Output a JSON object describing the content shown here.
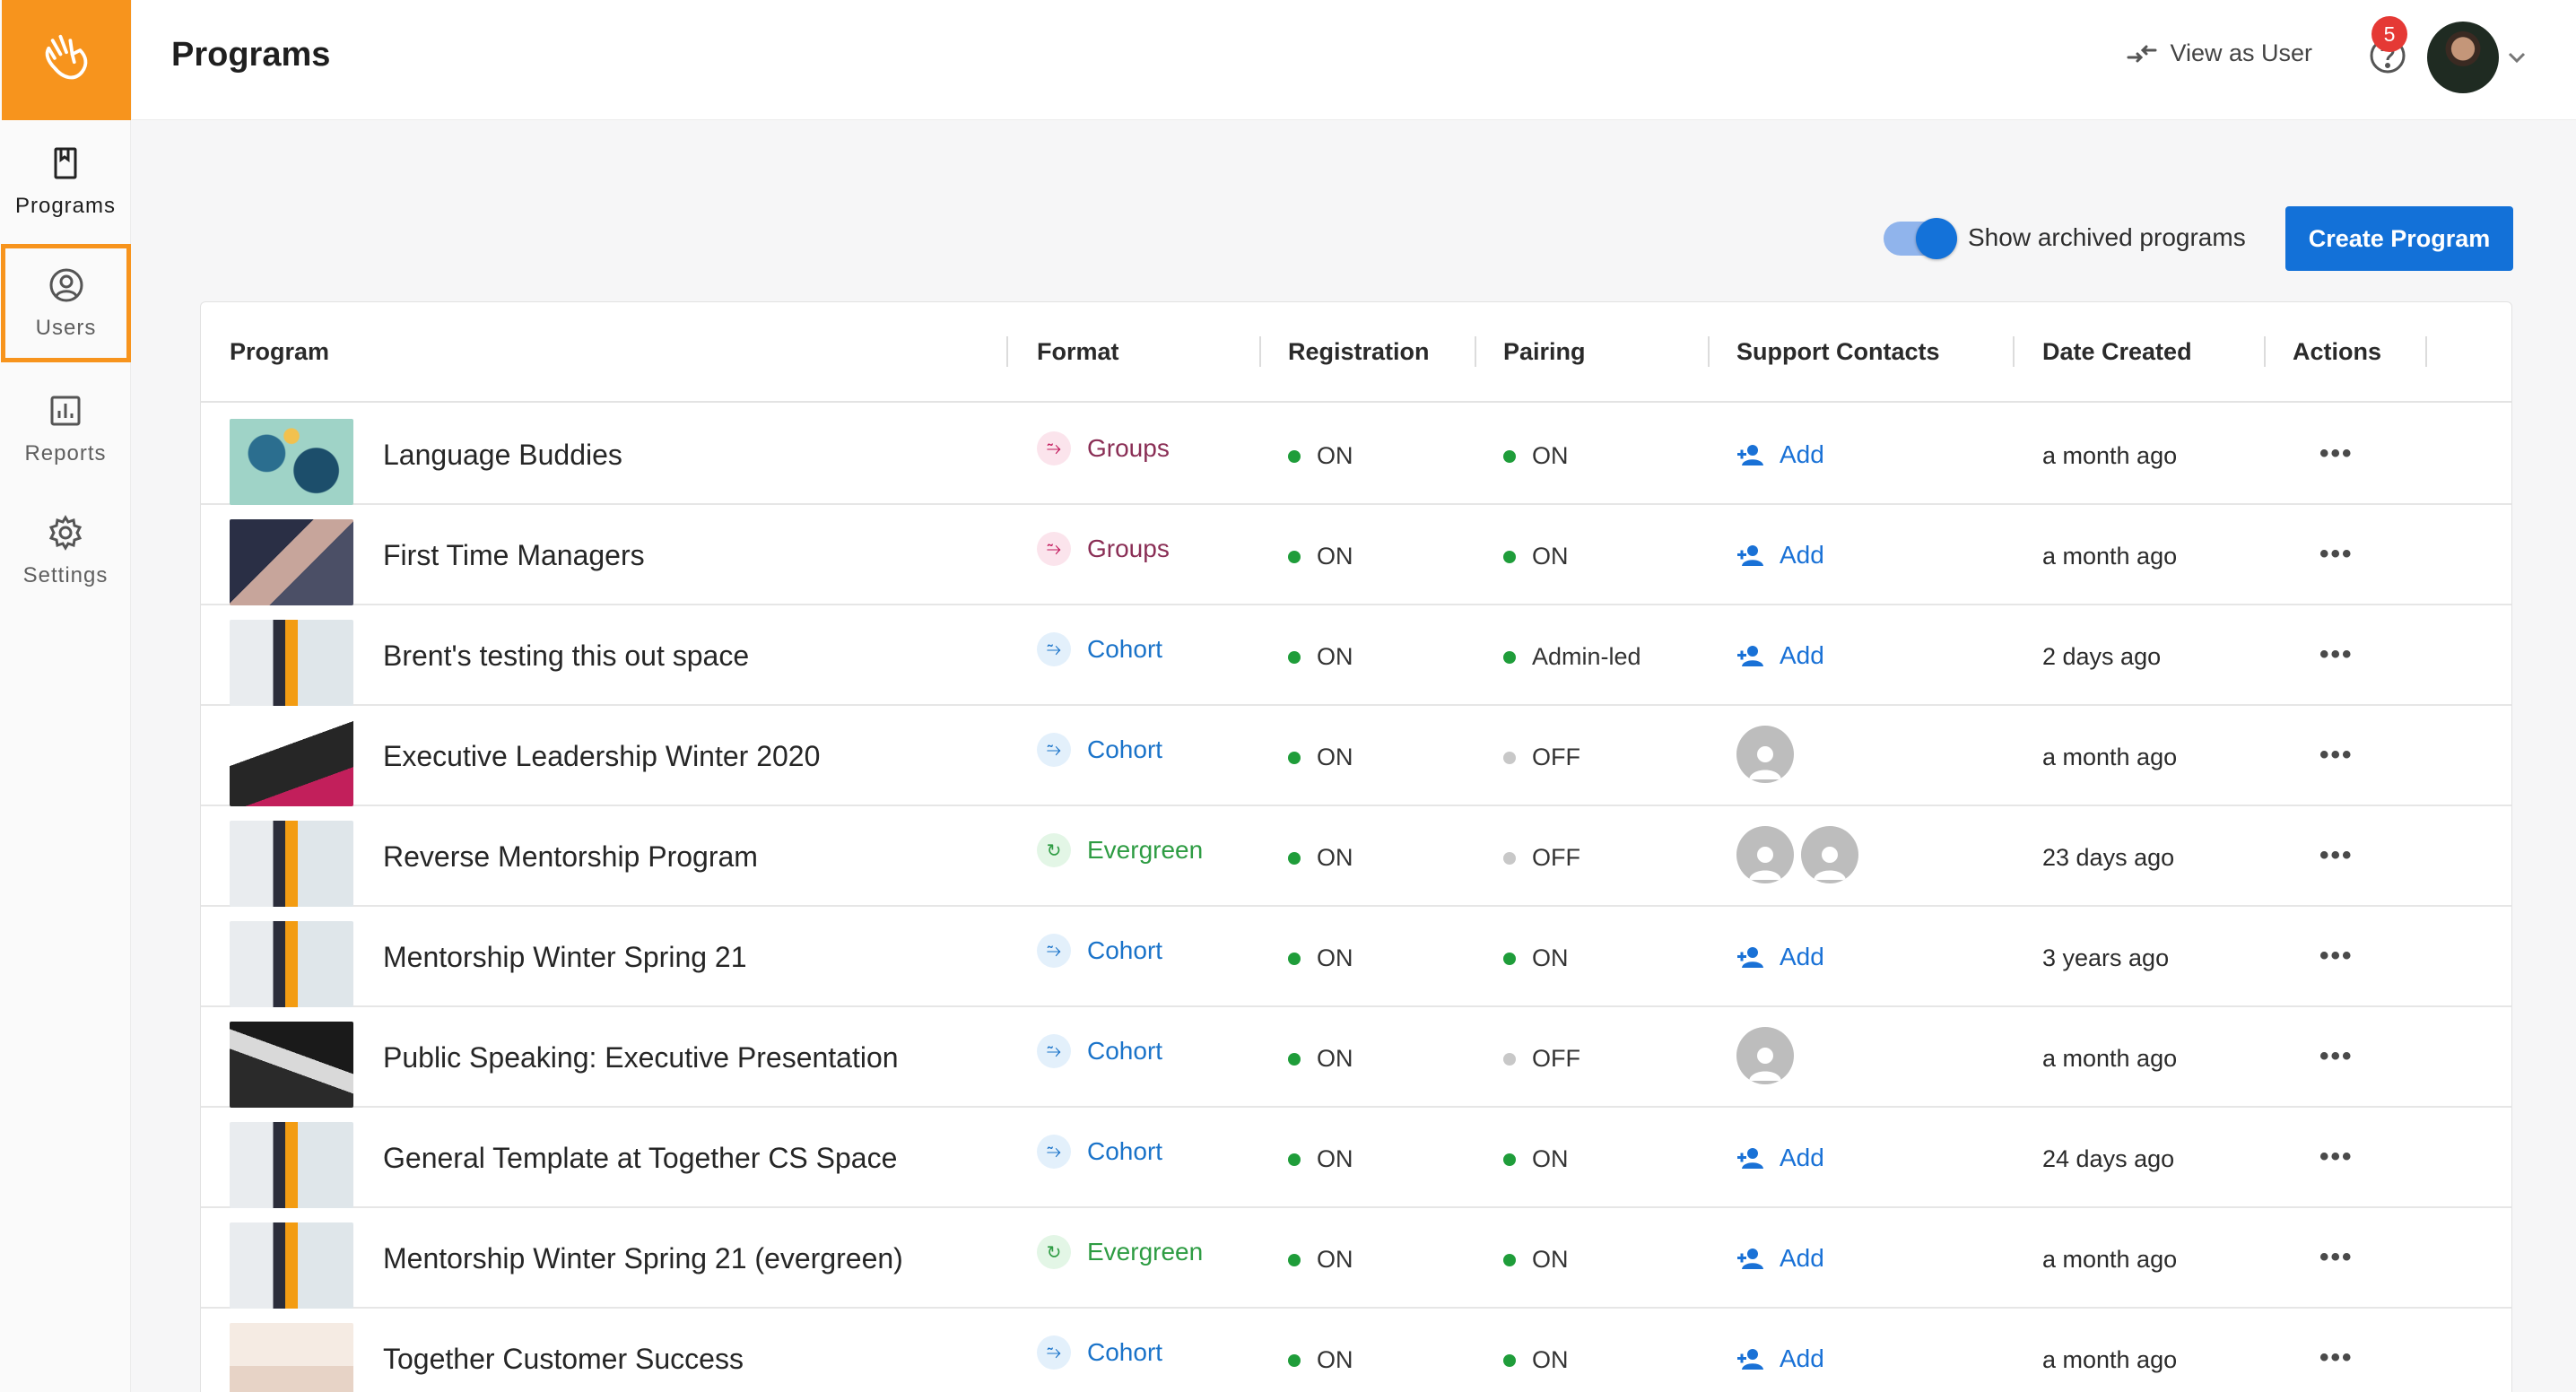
{
  "header": {
    "title": "Programs",
    "view_as_user": "View as User",
    "help_badge": "5"
  },
  "sidebar": {
    "items": [
      {
        "label": "Programs",
        "icon": "book-icon"
      },
      {
        "label": "Users",
        "icon": "user-circle-icon"
      },
      {
        "label": "Reports",
        "icon": "bar-chart-icon"
      },
      {
        "label": "Settings",
        "icon": "gear-icon"
      }
    ]
  },
  "toolbar": {
    "archived_label": "Show archived programs",
    "archived_on": true,
    "create_label": "Create Program"
  },
  "table": {
    "columns": [
      "Program",
      "Format",
      "Registration",
      "Pairing",
      "Support Contacts",
      "Date Created",
      "Actions"
    ],
    "rows": [
      {
        "name": "Language Buddies",
        "format": "Groups",
        "registration": "ON",
        "pairing": "ON",
        "contacts": "Add",
        "date": "a month ago"
      },
      {
        "name": "First Time Managers",
        "format": "Groups",
        "registration": "ON",
        "pairing": "ON",
        "contacts": "Add",
        "date": "a month ago"
      },
      {
        "name": "Brent's testing this out space",
        "format": "Cohort",
        "registration": "ON",
        "pairing": "Admin-led",
        "contacts": "Add",
        "date": "2 days ago"
      },
      {
        "name": "Executive Leadership Winter 2020",
        "format": "Cohort",
        "registration": "ON",
        "pairing": "OFF",
        "contacts": "",
        "date": "a month ago"
      },
      {
        "name": "Reverse Mentorship Program",
        "format": "Evergreen",
        "registration": "ON",
        "pairing": "OFF",
        "contacts": "",
        "date": "23 days ago"
      },
      {
        "name": "Mentorship Winter Spring 21",
        "format": "Cohort",
        "registration": "ON",
        "pairing": "ON",
        "contacts": "Add",
        "date": "3 years ago"
      },
      {
        "name": "Public Speaking: Executive Presentation",
        "format": "Cohort",
        "registration": "ON",
        "pairing": "OFF",
        "contacts": "",
        "date": "a month ago"
      },
      {
        "name": "General Template at Together CS Space",
        "format": "Cohort",
        "registration": "ON",
        "pairing": "ON",
        "contacts": "Add",
        "date": "24 days ago"
      },
      {
        "name": "Mentorship Winter Spring 21 (evergreen)",
        "format": "Evergreen",
        "registration": "ON",
        "pairing": "ON",
        "contacts": "Add",
        "date": "a month ago"
      },
      {
        "name": "Together Customer Success",
        "format": "Cohort",
        "registration": "ON",
        "pairing": "ON",
        "contacts": "Add",
        "date": "a month ago"
      }
    ]
  },
  "colors": {
    "brand": "#f7941d",
    "primary": "#1371d8",
    "on": "#1f9d3a",
    "off": "#c8c8c8",
    "groups": "#8a2e55",
    "cohort": "#1a73c9",
    "evergreen": "#2e9c43"
  }
}
